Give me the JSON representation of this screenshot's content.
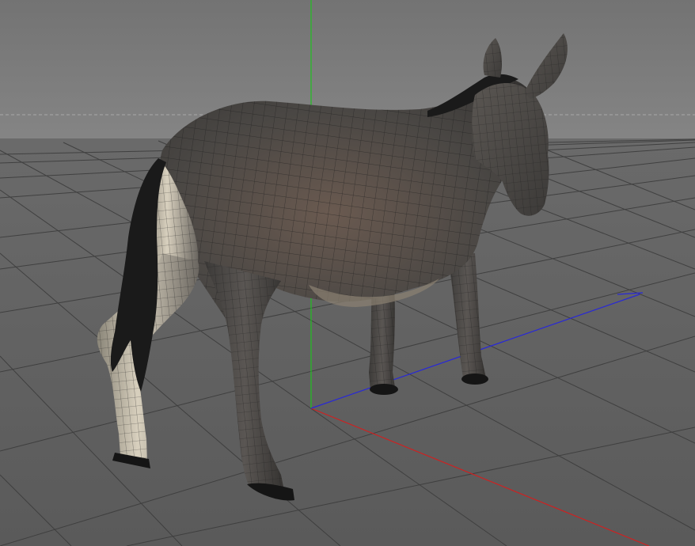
{
  "viewport": {
    "name": "3d-viewport",
    "colors": {
      "sky_top": "#737373",
      "sky_bottom": "#828282",
      "floor": "#5f5f5f",
      "grid": "#3a3a3a",
      "horizon": "#a8a8a8",
      "axis_x": "#d02020",
      "axis_y": "#20c020",
      "axis_z": "#2828d8",
      "model_body": "#4a4744",
      "model_light": "#cfc8b8",
      "wireframe": "#1a1a1a",
      "hooves": "#151515"
    },
    "model": {
      "name": "donkey",
      "shading": "wireframe-on-shaded"
    }
  }
}
